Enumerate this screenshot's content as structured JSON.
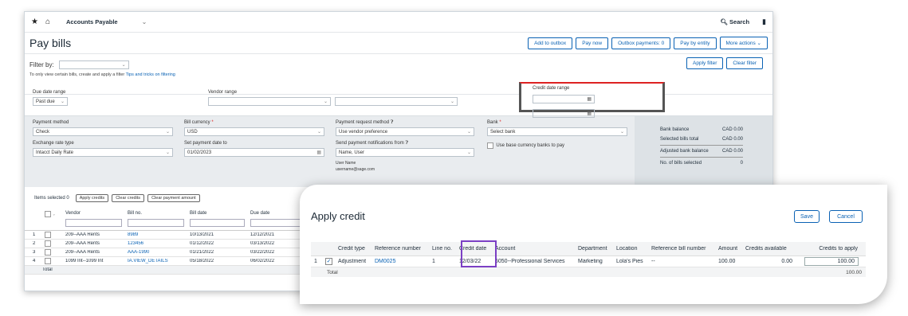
{
  "topbar": {
    "app": "Accounts Payable",
    "search": "Search"
  },
  "header": {
    "title": "Pay bills",
    "buttons": [
      "Add to outbox",
      "Pay now",
      "Outbox payments: 0",
      "Pay by entity",
      "More actions"
    ]
  },
  "filter": {
    "label": "Filter by:",
    "hint": "To only view certain bills, create and apply a filter",
    "hint_link": "Tips and tricks on filtering",
    "apply": "Apply filter",
    "clear": "Clear filter"
  },
  "ranges": {
    "due_label": "Due date range",
    "due_value": "Past due",
    "vendor_label": "Vendor range",
    "credit_label": "Credit date range"
  },
  "payment": {
    "method_label": "Payment method",
    "method_value": "Check",
    "currency_label": "Bill currency",
    "currency_value": "USD",
    "request_label": "Payment request method",
    "request_value": "Use vendor preference",
    "bank_label": "Bank",
    "bank_value": "Select bank",
    "exch_label": "Exchange rate type",
    "exch_value": "Intacct Daily Rate",
    "setdate_label": "Set payment date to",
    "setdate_value": "01/02/2023",
    "notif_label": "Send payment notifications from",
    "notif_value": "Name, User",
    "user_name": "User Name",
    "user_email": "username@sage.com",
    "base_currency": "Use base currency banks to pay"
  },
  "balance": {
    "bank_balance_label": "Bank balance",
    "bank_balance": "CAD 0.00",
    "selected_label": "Selected bills total",
    "selected": "CAD 0.00",
    "adjusted_label": "Adjusted bank balance",
    "adjusted": "CAD 0.00",
    "count_label": "No. of bills selected",
    "count": "0"
  },
  "items": {
    "selected": "Items selected 0",
    "apply_credits": "Apply credits",
    "clear_credits": "Clear credits",
    "clear_payment": "Clear payment amount"
  },
  "grid": {
    "headers": [
      "Vendor",
      "Bill no.",
      "Bill date",
      "Due date"
    ],
    "rows": [
      {
        "n": "1",
        "vendor": "209--AAA Rents",
        "bill": "8989",
        "bill_date": "10/13/2021",
        "due": "12/12/2021"
      },
      {
        "n": "2",
        "vendor": "209--AAA Rents",
        "bill": "123456",
        "bill_date": "01/12/2022",
        "due": "03/13/2022"
      },
      {
        "n": "3",
        "vendor": "209--AAA Rents",
        "bill": "AAA-1990",
        "bill_date": "01/21/2022",
        "due": "03/22/2022"
      },
      {
        "n": "4",
        "vendor": "1099 Int--1099 Int",
        "bill": "IA.VIEW_DETAILS",
        "bill_date": "05/18/2022",
        "due": "06/02/2022"
      }
    ],
    "total": "Total"
  },
  "apply_credit": {
    "title": "Apply credit",
    "save": "Save",
    "cancel": "Cancel",
    "headers": [
      "Credit type",
      "Reference number",
      "Line no.",
      "Credit date",
      "Account",
      "Department",
      "Location",
      "Reference bill number",
      "Amount",
      "Credits available",
      "Credits to apply"
    ],
    "row": {
      "n": "1",
      "type": "Adjustment",
      "ref": "DM0025",
      "line": "1",
      "date": "12/03/22",
      "account": "6050--Professional Services",
      "dept": "Marketing",
      "loc": "Lola's Pies",
      "refbill": "--",
      "amount": "100.00",
      "available": "0.00",
      "apply": "100.00"
    },
    "total_label": "Total",
    "total": "100.00"
  },
  "colors": {
    "accent": "#0a62b4",
    "highlight_purple": "#7b3fc4",
    "callout_red": "#dd2222"
  }
}
